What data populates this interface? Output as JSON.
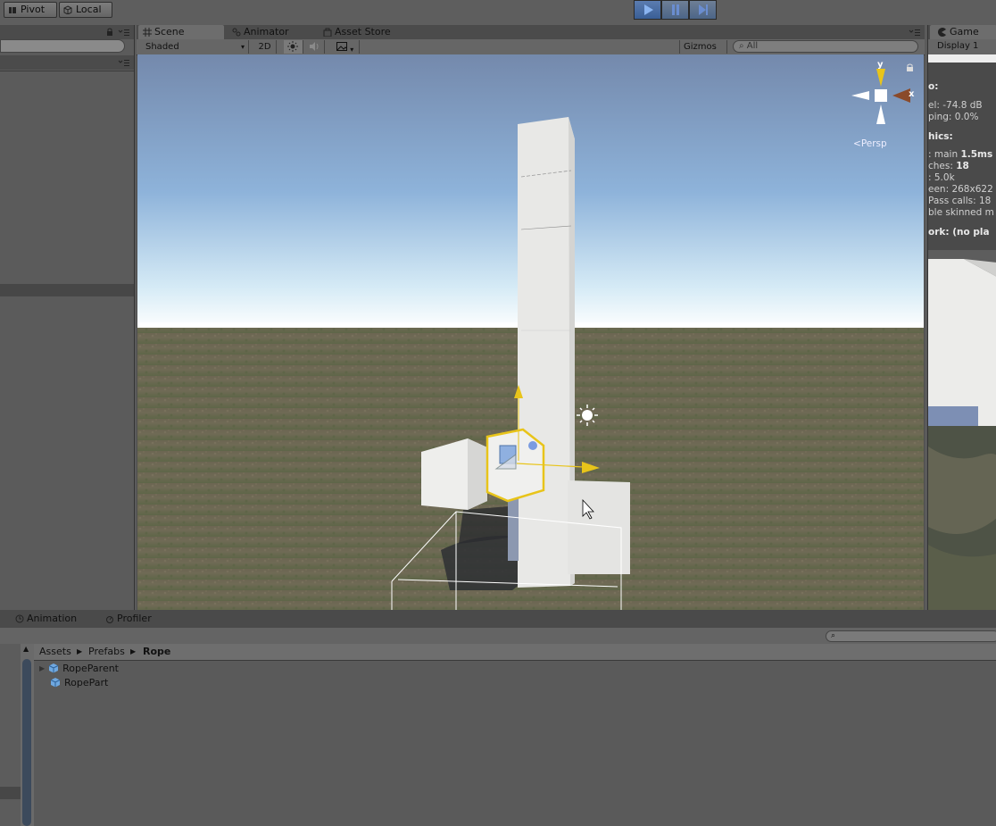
{
  "toolbar": {
    "pivot_label": "Pivot",
    "local_label": "Local"
  },
  "scene_tabs": [
    {
      "label": "Scene"
    },
    {
      "label": "Animator"
    },
    {
      "label": "Asset Store"
    }
  ],
  "scene_toolbar": {
    "shading_mode": "Shaded",
    "mode_2d": "2D",
    "gizmos_label": "Gizmos",
    "search_placeholder": "All"
  },
  "scene_view": {
    "persp_label": "Persp",
    "axis_y": "y",
    "axis_x": "x"
  },
  "game": {
    "tab_label": "Game",
    "display_label": "Display 1",
    "stats": [
      {
        "text": "o:",
        "bold": true
      },
      {
        "text": "el: -74.8 dB"
      },
      {
        "text": "ping: 0.0%"
      },
      {
        "text": "hics:",
        "bold": true
      },
      {
        "prefix": ": main ",
        "value": "1.5ms"
      },
      {
        "prefix": "ches: ",
        "value": "18"
      },
      {
        "text": ": 5.0k"
      },
      {
        "text": "een: 268x622"
      },
      {
        "text": "Pass calls: 18"
      },
      {
        "text": "ble skinned m"
      },
      {
        "text": "ork: (no pla",
        "bold": true
      }
    ]
  },
  "bottom_tabs": [
    {
      "label": "Animation"
    },
    {
      "label": "Profiler"
    }
  ],
  "breadcrumb": [
    "Assets",
    "Prefabs",
    "Rope"
  ],
  "assets": [
    {
      "label": "RopeParent",
      "expandable": true
    },
    {
      "label": "RopePart",
      "expandable": false
    }
  ],
  "colors": {
    "selection_outline": "#e8c41a",
    "play_active": "#4a74b8",
    "panel_bg": "#5b5b5b"
  }
}
